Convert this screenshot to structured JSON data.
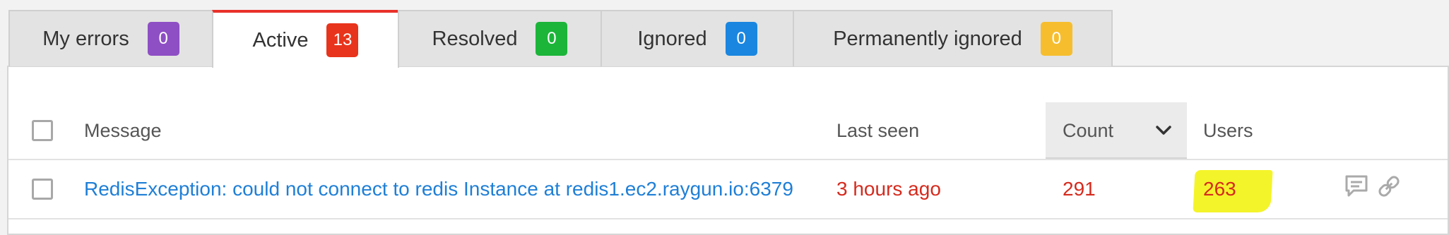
{
  "tabs": [
    {
      "label": "My errors",
      "count": "0",
      "color": "#8e4fc4",
      "active": false
    },
    {
      "label": "Active",
      "count": "13",
      "color": "#e8341c",
      "active": true
    },
    {
      "label": "Resolved",
      "count": "0",
      "color": "#1cb53a",
      "active": false
    },
    {
      "label": "Ignored",
      "count": "0",
      "color": "#1a86e0",
      "active": false
    },
    {
      "label": "Permanently ignored",
      "count": "0",
      "color": "#f6be2f",
      "active": false
    }
  ],
  "table": {
    "columns": {
      "message": "Message",
      "last_seen": "Last seen",
      "count": "Count",
      "users": "Users"
    },
    "sort_icon": "chevron-down-icon",
    "rows": [
      {
        "message": "RedisException: could not connect to redis Instance at redis1.ec2.raygun.io:6379",
        "last_seen": "3 hours ago",
        "count": "291",
        "users": "263",
        "icons": [
          "comment-icon",
          "link-icon"
        ]
      }
    ]
  },
  "colors": {
    "link": "#1f7fd6",
    "stat_red": "#d52b1e",
    "active_tab_accent": "#e8312a",
    "users_highlight": "#f4f42a"
  }
}
